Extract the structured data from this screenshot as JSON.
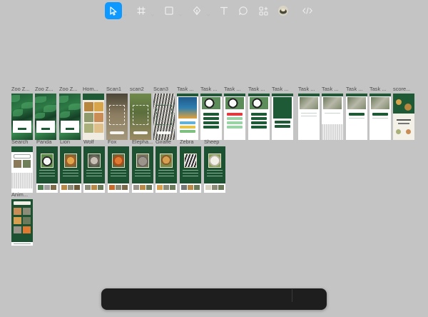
{
  "canvas": {
    "frames_row1": [
      {
        "label": "Zoo Z...",
        "kind": "jungle"
      },
      {
        "label": "Zoo Z...",
        "kind": "jungle"
      },
      {
        "label": "Zoo Z...",
        "kind": "jungle"
      },
      {
        "label": "Hom...",
        "kind": "home"
      },
      {
        "label": "Scan1",
        "kind": "photo",
        "color": "#7f7463"
      },
      {
        "label": "scan2",
        "kind": "photo",
        "color": "#6d7c55"
      },
      {
        "label": "Scan3",
        "kind": "photo",
        "color": "#8a8a7e"
      },
      {
        "label": "Task ...",
        "kind": "task-bird"
      },
      {
        "label": "Task ...",
        "kind": "task-panda"
      },
      {
        "label": "Task ...",
        "kind": "task-panda-red"
      },
      {
        "label": "Task ...",
        "kind": "task-panda-green"
      },
      {
        "label": "Task ...",
        "kind": "task-dark"
      },
      {
        "label": "Task ...",
        "kind": "task-koala"
      },
      {
        "label": "Task ...",
        "kind": "task-koala-keys"
      },
      {
        "label": "Task ...",
        "kind": "task-koala"
      },
      {
        "label": "Task ...",
        "kind": "task-koala"
      },
      {
        "label": "score...",
        "kind": "score"
      }
    ],
    "frames_row2": [
      {
        "label": "Search",
        "kind": "search"
      },
      {
        "label": "Panda",
        "kind": "green"
      },
      {
        "label": "Lion",
        "kind": "green"
      },
      {
        "label": "Wolf",
        "kind": "green"
      },
      {
        "label": "Fox",
        "kind": "green"
      },
      {
        "label": "Elepha...",
        "kind": "green"
      },
      {
        "label": "Giraffe",
        "kind": "green"
      },
      {
        "label": "Zebra",
        "kind": "green"
      },
      {
        "label": "Sheep",
        "kind": "green"
      }
    ],
    "frames_row3": [
      {
        "label": "Anim...",
        "kind": "animals"
      }
    ]
  },
  "toolbar": {
    "tools": [
      {
        "name": "move-tool",
        "icon": "cursor-arrow-icon",
        "active": true
      },
      {
        "name": "frame-tool",
        "icon": "hash-frame-icon",
        "active": false
      },
      {
        "name": "shape-tool",
        "icon": "rectangle-icon",
        "active": false
      },
      {
        "name": "pen-tool",
        "icon": "pen-nib-icon",
        "active": false
      },
      {
        "name": "text-tool",
        "icon": "text-t-icon",
        "active": false
      },
      {
        "name": "comment-tool",
        "icon": "comment-bubble-icon",
        "active": false
      },
      {
        "name": "resources-tool",
        "icon": "components-plus-icon",
        "active": false
      },
      {
        "name": "actions-tool",
        "icon": "actions-avatar-icon",
        "active": false
      },
      {
        "name": "dev-mode-toggle",
        "icon": "code-brackets-icon",
        "active": false
      }
    ],
    "active_color": "#0d99ff"
  }
}
